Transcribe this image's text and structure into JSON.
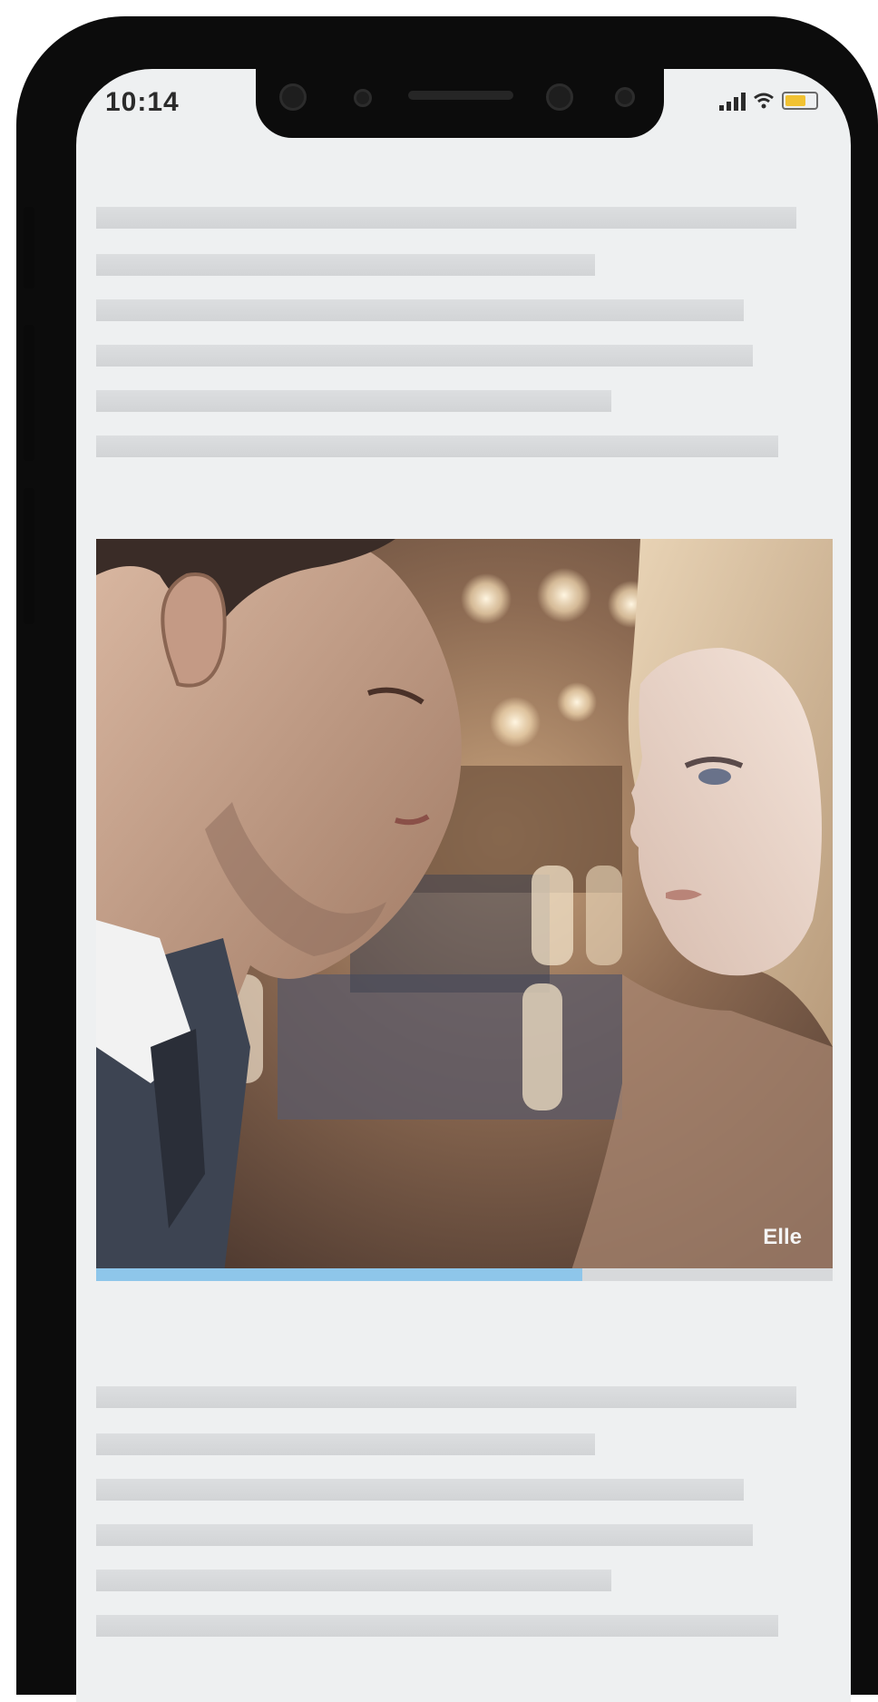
{
  "status_bar": {
    "time": "10:14",
    "battery_color": "#f1c232"
  },
  "article": {
    "caption_label": "",
    "credit_prefix": "",
    "credit_link": ""
  },
  "video": {
    "description": "",
    "progress_fraction": 0.66,
    "progress_color": "#8ec6ea"
  },
  "icons": [
    "camera-icon",
    "signal-icon",
    "wifi-icon",
    "battery-icon",
    "video-logo-icon"
  ],
  "colors": {
    "screen_background": "#eef0f1",
    "skeleton": "#d6d8da",
    "link": "#56b7ef"
  }
}
